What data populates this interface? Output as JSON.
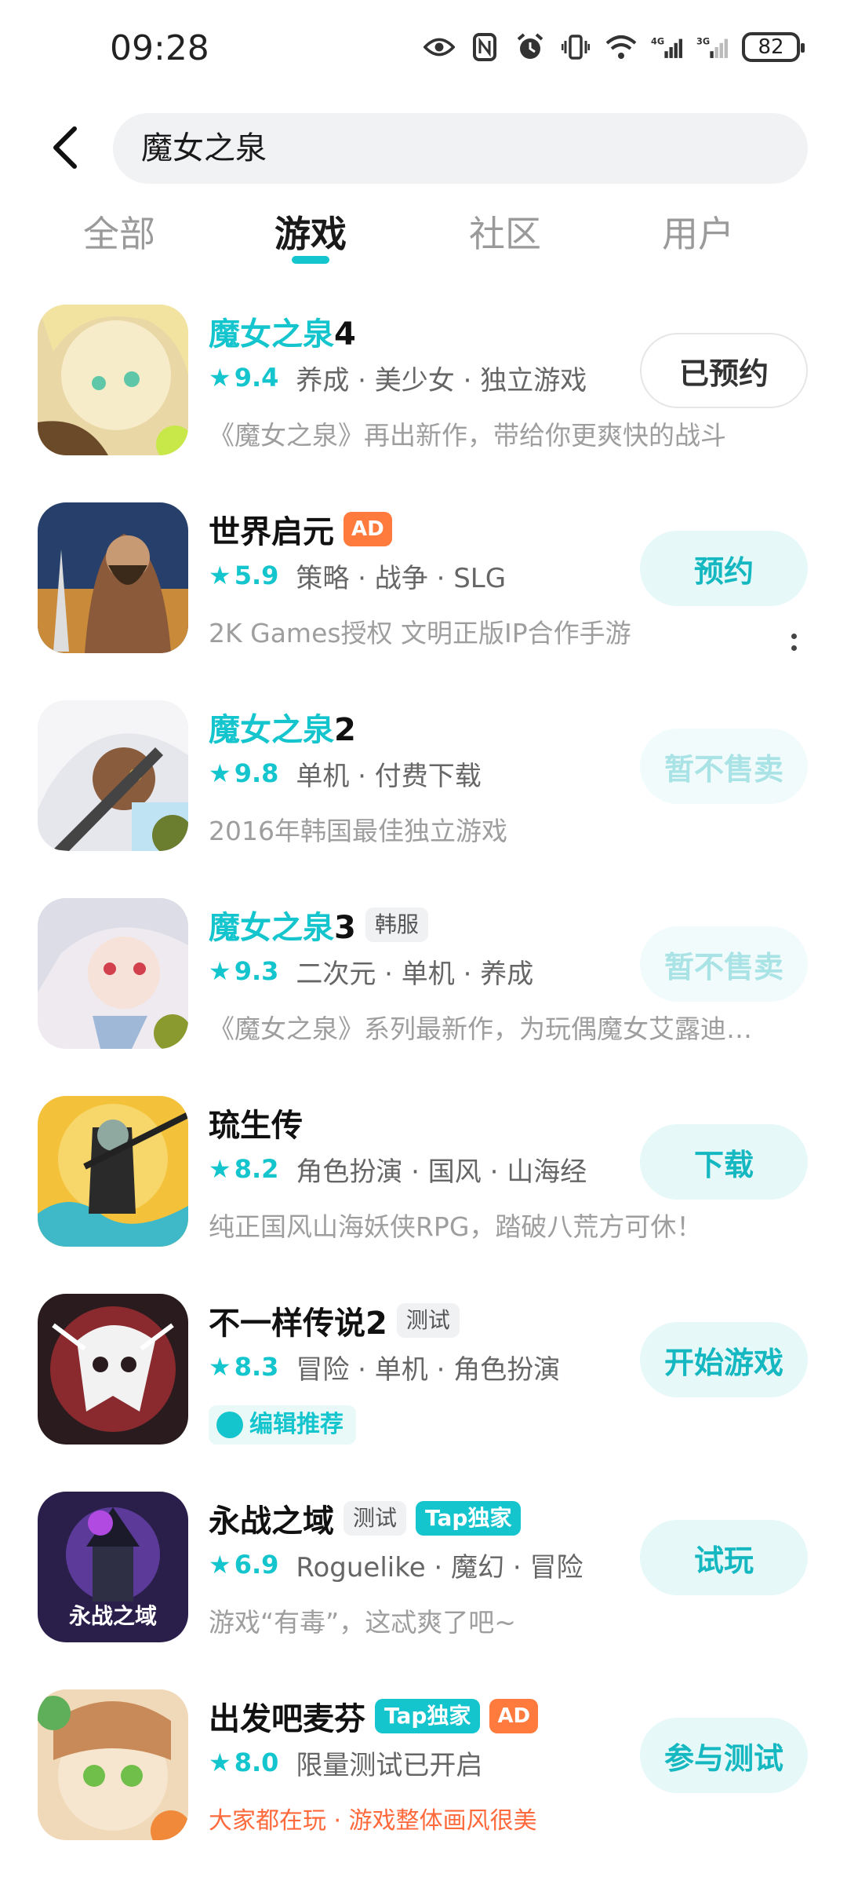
{
  "status_bar": {
    "time": "09:28",
    "battery": "82"
  },
  "search": {
    "query": "魔女之泉"
  },
  "tabs": [
    {
      "label": "全部"
    },
    {
      "label": "游戏"
    },
    {
      "label": "社区"
    },
    {
      "label": "用户"
    }
  ],
  "colors": {
    "accent": "#15c5ce",
    "ad_badge": "#ff7a3d",
    "muted_text": "#9e9e9e"
  },
  "items": [
    {
      "title_hl": "魔女之泉",
      "title_rest": "4",
      "rating": "9.4",
      "tags": "养成 · 美少女 · 独立游戏",
      "desc": "《魔女之泉》再出新作，带给你更爽快的战斗",
      "action": "已预约"
    },
    {
      "title_rest": "世界启元",
      "ad": "AD",
      "rating": "5.9",
      "tags": "策略 · 战争 · SLG",
      "desc": "2K Games授权 文明正版IP合作手游",
      "action": "预约"
    },
    {
      "title_hl": "魔女之泉",
      "title_rest": "2",
      "rating": "9.8",
      "tags": "单机 · 付费下载",
      "desc": "2016年韩国最佳独立游戏",
      "action": "暂不售卖"
    },
    {
      "title_hl": "魔女之泉",
      "title_rest": "3",
      "badge": "韩服",
      "rating": "9.3",
      "tags": "二次元 · 单机 · 养成",
      "desc": "《魔女之泉》系列最新作，为玩偶魔女艾露迪…",
      "action": "暂不售卖"
    },
    {
      "title_rest": "琉生传",
      "rating": "8.2",
      "tags": "角色扮演 · 国风 · 山海经",
      "desc": "纯正国风山海妖侠RPG，踏破八荒方可休！",
      "action": "下载"
    },
    {
      "title_rest": "不一样传说2",
      "badge": "测试",
      "rating": "8.3",
      "tags": "冒险 · 单机 · 角色扮演",
      "editor": "编辑推荐",
      "action": "开始游戏"
    },
    {
      "title_rest": "永战之域",
      "badge": "测试",
      "tap": "Tap独家",
      "rating": "6.9",
      "tags": "Roguelike · 魔幻 · 冒险",
      "desc": "游戏“有毒”，这忒爽了吧~",
      "action": "试玩"
    },
    {
      "title_rest": "出发吧麦芬",
      "tap": "Tap独家",
      "ad": "AD",
      "rating": "8.0",
      "tags": "限量测试已开启",
      "promo": "大家都在玩 · 游戏整体画风很美",
      "action": "参与测试"
    }
  ]
}
